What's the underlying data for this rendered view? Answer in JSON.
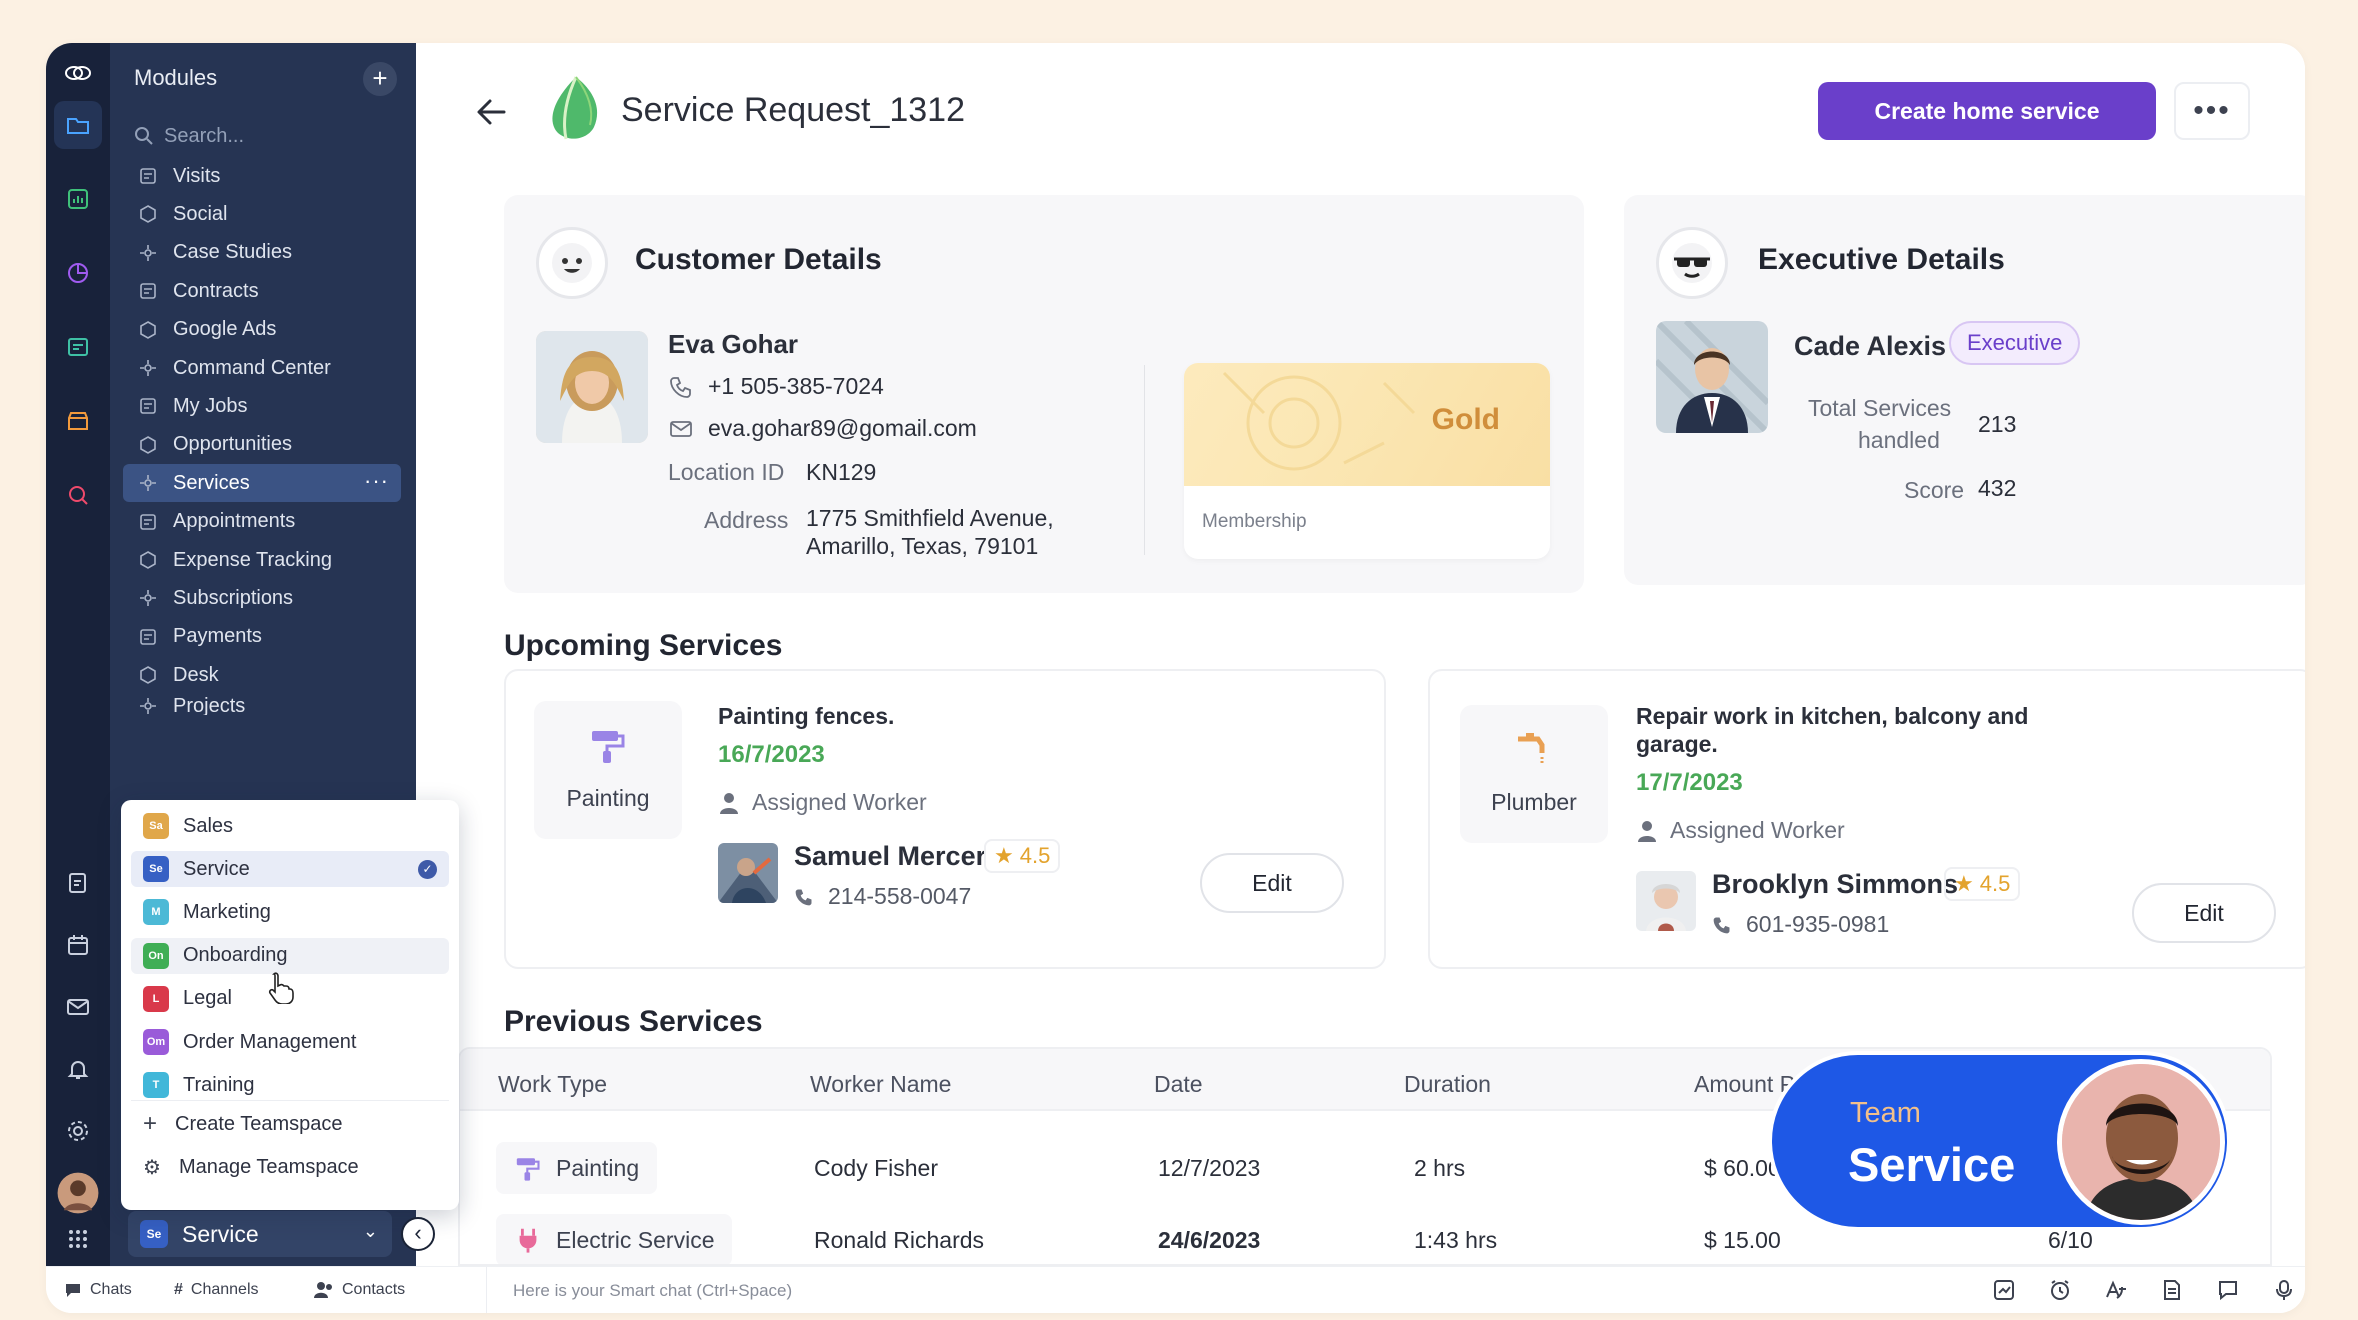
{
  "sidebar": {
    "title": "Modules",
    "search_placeholder": "Search...",
    "items": [
      {
        "label": "Visits"
      },
      {
        "label": "Social"
      },
      {
        "label": "Case Studies"
      },
      {
        "label": "Contracts"
      },
      {
        "label": "Google Ads"
      },
      {
        "label": "Command Center"
      },
      {
        "label": "My Jobs"
      },
      {
        "label": "Opportunities"
      },
      {
        "label": "Services"
      },
      {
        "label": "Appointments"
      },
      {
        "label": "Expense Tracking"
      },
      {
        "label": "Subscriptions"
      },
      {
        "label": "Payments"
      },
      {
        "label": "Desk"
      },
      {
        "label": "Projects"
      }
    ],
    "selected": "Services",
    "more_label": "···"
  },
  "teamspaces": {
    "items": [
      {
        "badge": "Sa",
        "label": "Sales",
        "color": "#e0a74a"
      },
      {
        "badge": "Se",
        "label": "Service",
        "color": "#3660c4"
      },
      {
        "badge": "M",
        "label": "Marketing",
        "color": "#4cb9d6"
      },
      {
        "badge": "On",
        "label": "Onboarding",
        "color": "#3fae55"
      },
      {
        "badge": "L",
        "label": "Legal",
        "color": "#d9394a"
      },
      {
        "badge": "Om",
        "label": "Order Management",
        "color": "#9a5bd9"
      },
      {
        "badge": "T",
        "label": "Training",
        "color": "#41b7d9"
      }
    ],
    "create": "Create Teamspace",
    "manage": "Manage Teamspace",
    "current_badge": "Se",
    "current": "Service"
  },
  "bottombar": {
    "chats": "Chats",
    "channels": "Channels",
    "contacts": "Contacts",
    "smart_chat": "Here is your Smart chat (Ctrl+Space)"
  },
  "header": {
    "title": "Service Request_1312",
    "primary_button": "Create home service",
    "more": "•••"
  },
  "customer": {
    "heading": "Customer Details",
    "name": "Eva Gohar",
    "phone": "+1 505-385-7024",
    "email": "eva.gohar89@gomail.com",
    "location_label": "Location ID",
    "location": "KN129",
    "address_label": "Address",
    "address_line1": "1775 Smithfield Avenue,",
    "address_line2": "Amarillo, Texas, 79101",
    "membership_tier": "Gold",
    "membership_label": "Membership"
  },
  "executive": {
    "heading": "Executive Details",
    "name": "Cade Alexis",
    "badge": "Executive",
    "total_label_1": "Total Services",
    "total_label_2": "handled",
    "total": "213",
    "score_label": "Score",
    "score": "432"
  },
  "upcoming": {
    "heading": "Upcoming Services",
    "cards": [
      {
        "tile": "Painting",
        "title": "Painting fences.",
        "title2": "",
        "date": "16/7/2023",
        "worker_label": "Assigned Worker",
        "worker": "Samuel Mercer",
        "rating": "4.5",
        "phone": "214-558-0047",
        "edit": "Edit"
      },
      {
        "tile": "Plumber",
        "title": "Repair work in kitchen, balcony and",
        "title2": "garage.",
        "date": "17/7/2023",
        "worker_label": "Assigned Worker",
        "worker": "Brooklyn Simmons",
        "rating": "4.5",
        "phone": "601-935-0981",
        "edit": "Edit"
      }
    ]
  },
  "previous": {
    "heading": "Previous Services",
    "columns": [
      "Work Type",
      "Worker Name",
      "Date",
      "Duration",
      "Amount P"
    ],
    "rows": [
      {
        "type": "Painting",
        "worker": "Cody Fisher",
        "date": "12/7/2023",
        "duration": "2 hrs",
        "amount": "$ 60.00",
        "extra": ""
      },
      {
        "type": "Electric Service",
        "worker": "Ronald Richards",
        "date": "24/6/2023",
        "duration": "1:43 hrs",
        "amount": "$ 15.00",
        "extra": "6/10"
      }
    ]
  },
  "team_badge": {
    "line1": "Team",
    "line2": "Service"
  },
  "colors": {
    "accent": "#6a3fca",
    "sidebar": "#263453",
    "date_green": "#49a857",
    "badge_blue": "#1e58e6"
  }
}
